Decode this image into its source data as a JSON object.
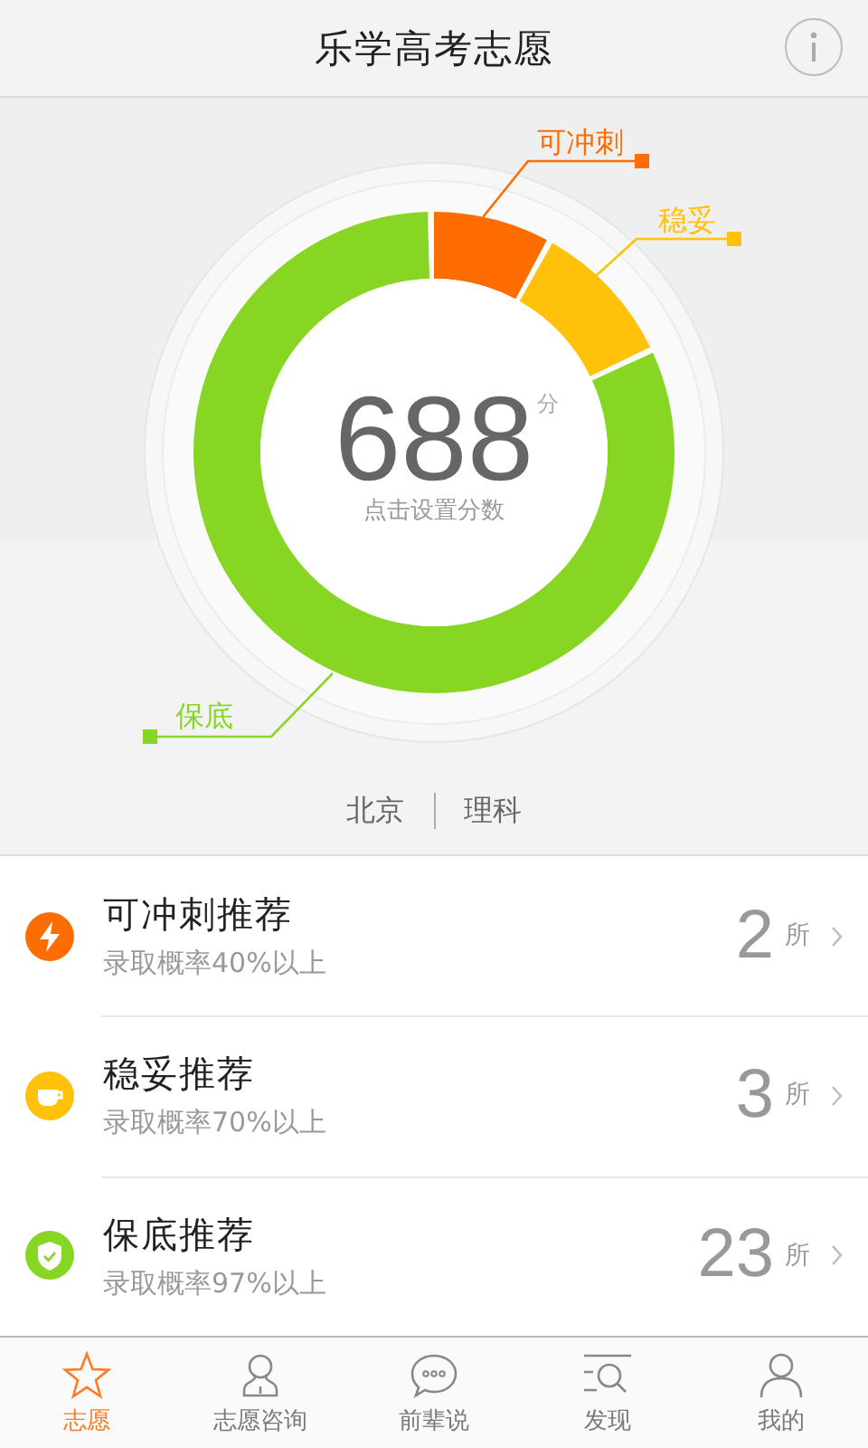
{
  "header": {
    "title": "乐学高考志愿"
  },
  "score": {
    "value": "688",
    "unit": "分",
    "hint": "点击设置分数"
  },
  "segments": [
    {
      "label": "可冲刺",
      "color": "#ff6d00"
    },
    {
      "label": "稳妥",
      "color": "#ffc10a"
    },
    {
      "label": "保底",
      "color": "#88d624"
    }
  ],
  "location": {
    "region": "北京",
    "track": "理科"
  },
  "recommendations": [
    {
      "kind": "reach",
      "color": "#ff6d00",
      "title": "可冲刺推荐",
      "subtitle": "录取概率40%以上",
      "count": "2",
      "unit": "所"
    },
    {
      "kind": "safe",
      "color": "#ffc10a",
      "title": "稳妥推荐",
      "subtitle": "录取概率70%以上",
      "count": "3",
      "unit": "所"
    },
    {
      "kind": "floor",
      "color": "#88d624",
      "title": "保底推荐",
      "subtitle": "录取概率97%以上",
      "count": "23",
      "unit": "所"
    }
  ],
  "tabs": [
    {
      "label": "志愿",
      "selected": true
    },
    {
      "label": "志愿咨询",
      "selected": false
    },
    {
      "label": "前辈说",
      "selected": false
    },
    {
      "label": "发现",
      "selected": false
    },
    {
      "label": "我的",
      "selected": false
    }
  ]
}
